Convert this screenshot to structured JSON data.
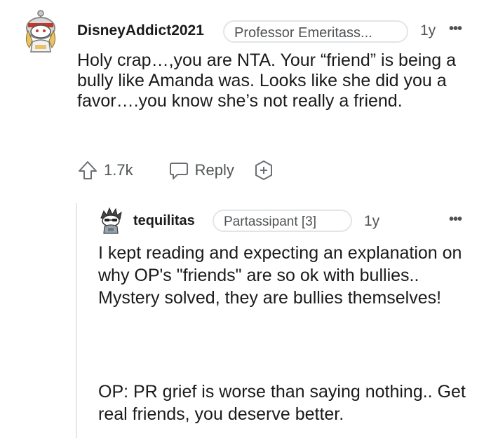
{
  "comment": {
    "username": "DisneyAddict2021",
    "flair": "Professor Emeritass...",
    "age": "1y",
    "more_label": "•••",
    "body": "Holy crap…,you are NTA. Your “friend” is being a bully like Amanda was. Looks like she did you a favor….you know she’s not really a friend.",
    "votes": "1.7k",
    "reply_label": "Reply"
  },
  "reply": {
    "username": "tequilitas",
    "flair": "Partassipant [3]",
    "age": "1y",
    "more_label": "•••",
    "paragraph_1": "I kept reading and expecting an explanation on why OP's \"friends\" are so ok with bullies.. Mystery solved, they are bullies themselves!",
    "paragraph_2": "OP: PR grief is worse than saying nothing.. Get real friends, you deserve better."
  },
  "colors": {
    "text": "#1a1a1b",
    "meta": "#4f5355",
    "icon": "#6b6f72",
    "flair_border": "#e3e5e7",
    "thread_line": "#e4e6e8"
  },
  "icons": [
    "snoo-avatar-icon",
    "upvote-icon",
    "reply-bubble-icon",
    "award-icon",
    "more-options-icon"
  ]
}
